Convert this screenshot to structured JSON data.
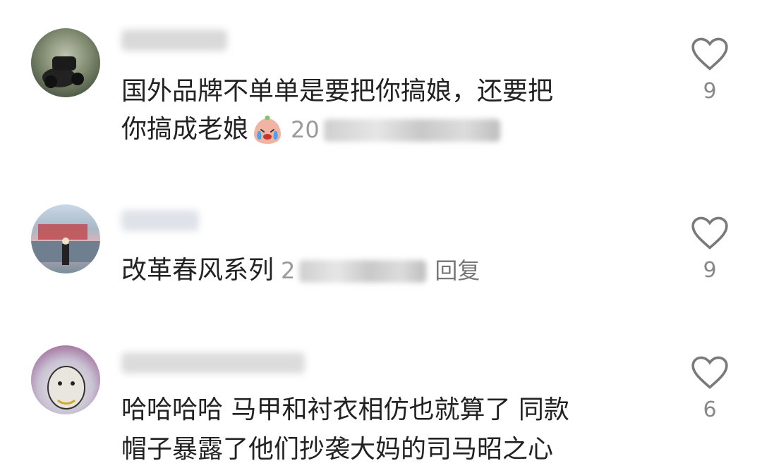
{
  "comments": [
    {
      "text_lines": [
        "国外品牌不单单是要把你搞娘，还要把",
        "你搞成老娘"
      ],
      "time_prefix": "20",
      "reply_label": "",
      "likes": "9",
      "emoji": "crying-laugh-emoji"
    },
    {
      "text_lines": [
        "改革春风系列"
      ],
      "time_prefix": "2",
      "reply_label": "回复",
      "likes": "9"
    },
    {
      "text_lines": [
        "哈哈哈哈 马甲和衬衣相仿也就算了 同款",
        "帽子暴露了他们抄袭大妈的司马昭之心"
      ],
      "likes": "6"
    }
  ],
  "colors": {
    "text": "#222222",
    "muted": "#888888",
    "icon": "#7a7a7a"
  }
}
